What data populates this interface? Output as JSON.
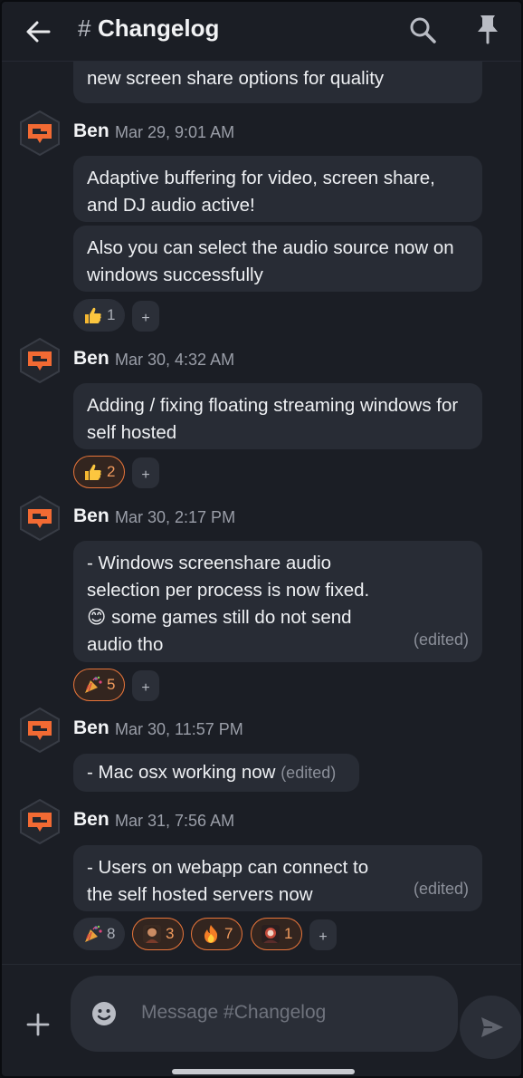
{
  "header": {
    "hash": "#",
    "channel": "Changelog"
  },
  "messages": {
    "partial_top": "new screen share options for quality",
    "groups": [
      {
        "author": "Ben",
        "time": "Mar 29, 9:01 AM",
        "bubbles": [
          "Adaptive buffering for video, screen share, and DJ audio active!",
          "Also you can select the audio source now on windows successfully"
        ],
        "reactions": [
          {
            "emoji": "thumbs-up",
            "count": "1",
            "active": false
          }
        ]
      },
      {
        "author": "Ben",
        "time": "Mar 30, 4:32 AM",
        "bubbles": [
          "Adding / fixing floating streaming windows for self hosted"
        ],
        "reactions": [
          {
            "emoji": "thumbs-up",
            "count": "2",
            "active": true
          }
        ]
      },
      {
        "author": "Ben",
        "time": "Mar 30, 2:17 PM",
        "bubbles": [
          "- Windows screenshare audio selection per process is now fixed. 😊 some games still do not send audio tho"
        ],
        "edited": "(edited)",
        "reactions": [
          {
            "emoji": "party-popper",
            "count": "5",
            "active": true
          }
        ]
      },
      {
        "author": "Ben",
        "time": "Mar 30, 11:57 PM",
        "bubbles": [
          "- Mac osx working now"
        ],
        "edited": "(edited)"
      },
      {
        "author": "Ben",
        "time": "Mar 31, 7:56 AM",
        "bubbles": [
          "- Users on webapp can connect to the self hosted servers now"
        ],
        "edited": "(edited)",
        "reactions": [
          {
            "emoji": "party-popper",
            "count": "8",
            "active": false
          },
          {
            "emoji": "custom-avatar-1",
            "count": "3",
            "active": true
          },
          {
            "emoji": "fire",
            "count": "7",
            "active": true
          },
          {
            "emoji": "custom-avatar-2",
            "count": "1",
            "active": true
          }
        ]
      }
    ],
    "add_reaction_symbol": "+"
  },
  "composer": {
    "placeholder": "Message #Changelog"
  },
  "colors": {
    "background": "#1b1e25",
    "bubble": "#282c35",
    "accent": "#e8753a",
    "avatar_orange": "#f26a33"
  }
}
